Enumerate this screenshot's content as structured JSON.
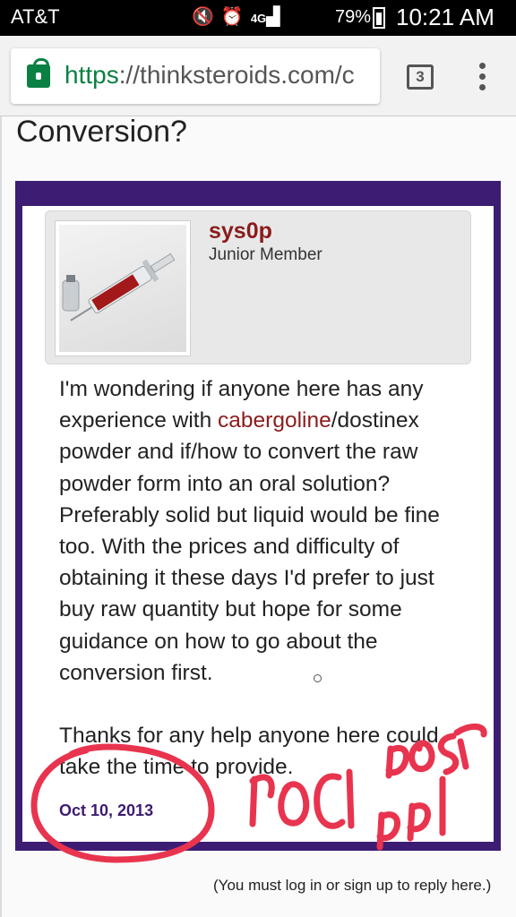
{
  "status_bar": {
    "carrier": "AT&T",
    "icons": [
      "mute-icon",
      "alarm-icon",
      "4g-lte-icon",
      "signal-icon"
    ],
    "network": "4G LTE",
    "battery_pct": "79%",
    "time": "10:21 AM"
  },
  "browser": {
    "url_scheme": "https",
    "url_rest": "://thinksteroids.com/c",
    "tab_count": "3"
  },
  "page": {
    "title_fragment": "Conversion?",
    "post": {
      "author_name": "sys0p",
      "author_role": "Junior Member",
      "body_before_link": "I'm wondering if anyone here has any experience with ",
      "body_link": "cabergoline",
      "body_after_link": "/dostinex powder and if/how to convert the raw powder form into an oral solution? Preferably solid but liquid would be fine too. With the prices and difficulty of obtaining it these days I'd prefer to just buy raw quantity but hope for some guidance on how to go about the conversion first.",
      "body_paragraph_2": "Thanks for any help anyone here could take the time to provide.",
      "date": "Oct 10, 2013"
    },
    "reply_note": "(You must log in or sign up to reply here.)"
  },
  "annotation": {
    "color": "#e8344e"
  }
}
